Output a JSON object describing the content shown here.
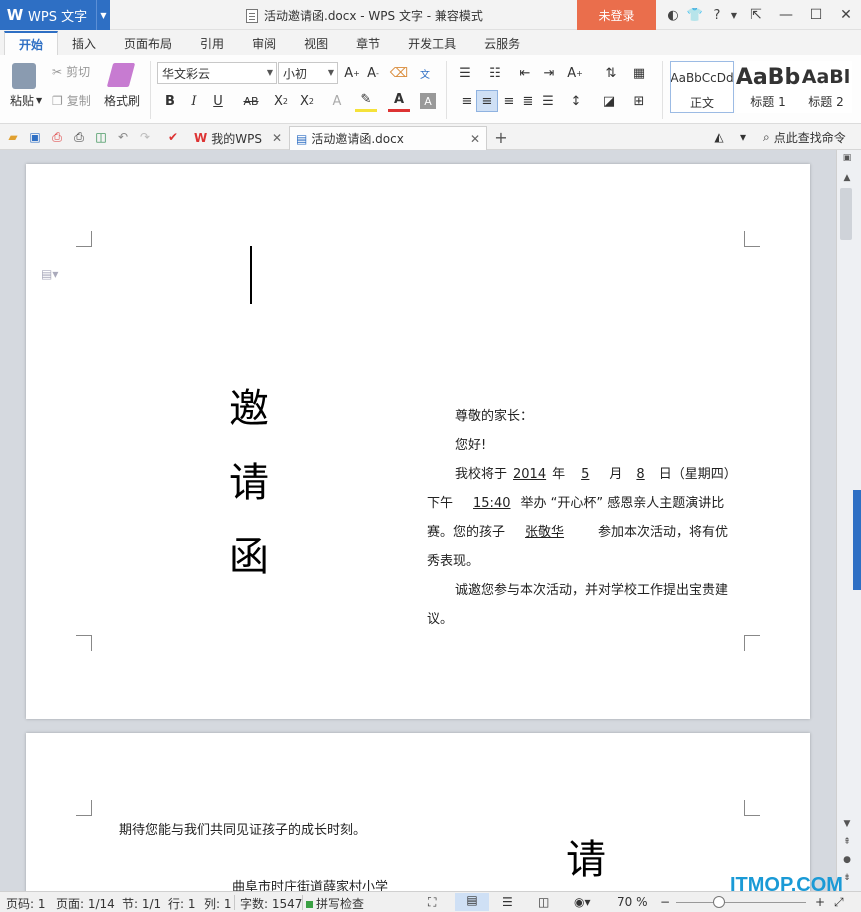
{
  "app": {
    "name": "WPS 文字",
    "logo_char": "W",
    "window_title": "活动邀请函.docx - WPS 文字 - 兼容模式",
    "login": "未登录"
  },
  "ribbon_tabs": [
    "开始",
    "插入",
    "页面布局",
    "引用",
    "审阅",
    "视图",
    "章节",
    "开发工具",
    "云服务"
  ],
  "ribbon": {
    "paste": "粘贴",
    "cut": "剪切",
    "copy": "复制",
    "format_painter": "格式刷",
    "font_name": "华文彩云",
    "font_size": "小初",
    "styles": [
      {
        "sample": "AaBbCcDd",
        "name": "正文"
      },
      {
        "sample": "AaBb",
        "name": "标题 1"
      },
      {
        "sample": "AaBl",
        "name": "标题 2"
      }
    ]
  },
  "doc_tabs": {
    "home": "我的WPS",
    "current": "活动邀请函.docx",
    "find_command": "点此查找命令"
  },
  "document": {
    "vertical_title": [
      "邀",
      "请",
      "函"
    ],
    "greeting": "尊敬的家长：",
    "hello": "您好!",
    "line1_pre": "我校将于",
    "year": "2014",
    "line1_year_unit": "年",
    "month": "5",
    "line1_month_unit": "月",
    "day": "8",
    "line1_day_unit": "日（星期四）",
    "line2_pre": "下午",
    "time": "15:40",
    "line2_post": "举办 “开心杯” 感恩亲人主题演讲比",
    "line3_pre": "赛。您的孩子",
    "child_name": "张敬华",
    "line3_post": "参加本次活动，将有优",
    "line4": "秀表现。",
    "line5": "诚邀您参与本次活动，并对学校工作提出宝贵建",
    "line6": "议。",
    "page2_line": "期待您能与我们共同见证孩子的成长时刻。",
    "page2_char": "请",
    "page2_school": "曲阜市时庄街道薛家村小学"
  },
  "status": {
    "page_code": "页码: 1",
    "page": "页面: 1/14",
    "section": "节: 1/1",
    "row": "行: 1",
    "col": "列: 1",
    "word_count": "字数: 1547",
    "spell_check": "拼写检查",
    "zoom": "70 %"
  },
  "watermark": "ITMOP.COM",
  "colors": {
    "accent": "#2e6fc4",
    "login": "#ea6e4c",
    "watermark": "#1a9ad6"
  }
}
